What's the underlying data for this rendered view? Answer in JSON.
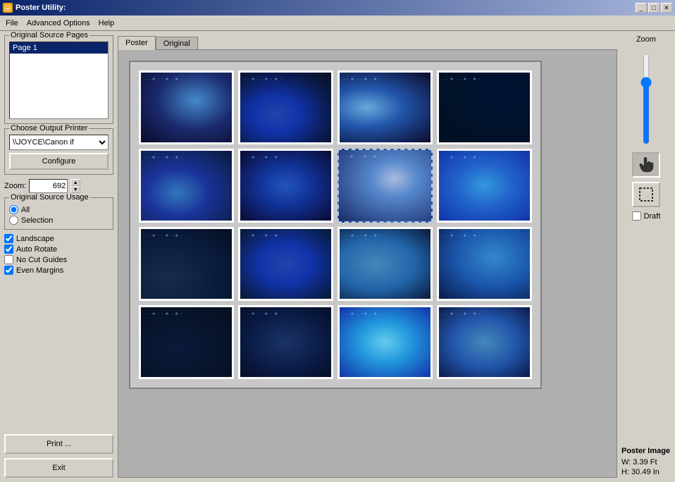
{
  "window": {
    "title": "Poster Utility:",
    "title_icon": "🖨"
  },
  "titlebar": {
    "minimize_label": "_",
    "maximize_label": "□",
    "close_label": "✕"
  },
  "menubar": {
    "items": [
      {
        "id": "file",
        "label": "File"
      },
      {
        "id": "advanced-options",
        "label": "Advanced Options"
      },
      {
        "id": "help",
        "label": "Help"
      }
    ]
  },
  "left_panel": {
    "source_pages_group_title": "Original Source Pages",
    "pages": [
      {
        "id": "page1",
        "label": "Page 1",
        "selected": true
      }
    ],
    "output_printer_group_title": "Choose Output Printer",
    "printer_value": "\\\\JOYCE\\Canon if",
    "configure_label": "Configure",
    "zoom_label": "Zoom:",
    "zoom_value": "692",
    "source_usage_group_title": "Original Source Usage",
    "radio_all_label": "All",
    "radio_selection_label": "Selection",
    "radio_all_checked": true,
    "radio_selection_checked": false,
    "checkbox_landscape_label": "Landscape",
    "checkbox_landscape_checked": true,
    "checkbox_auto_rotate_label": "Auto Rotate",
    "checkbox_auto_rotate_checked": true,
    "checkbox_no_cut_guides_label": "No Cut Guides",
    "checkbox_no_cut_guides_checked": false,
    "checkbox_even_margins_label": "Even Margins",
    "checkbox_even_margins_checked": true,
    "print_label": "Print ...",
    "exit_label": "Exit"
  },
  "center": {
    "tab_poster_label": "Poster",
    "tab_original_label": "Original",
    "active_tab": "poster"
  },
  "right_panel": {
    "zoom_label": "Zoom",
    "zoom_slider_value": 70,
    "hand_tool_icon": "✋",
    "select_tool_icon": "⬚",
    "draft_label": "Draft",
    "draft_checked": false,
    "poster_image_title": "Poster Image",
    "poster_width_label": "W: 3.39 Ft",
    "poster_height_label": "H: 30.49 In"
  },
  "poster_grid": {
    "cells": [
      {
        "id": 1,
        "class": "img-1"
      },
      {
        "id": 2,
        "class": "img-2"
      },
      {
        "id": 3,
        "class": "img-3"
      },
      {
        "id": 4,
        "class": "img-4"
      },
      {
        "id": 5,
        "class": "img-5"
      },
      {
        "id": 6,
        "class": "img-6"
      },
      {
        "id": 7,
        "class": "img-7",
        "dashed": true
      },
      {
        "id": 8,
        "class": "img-8"
      },
      {
        "id": 9,
        "class": "img-9"
      },
      {
        "id": 10,
        "class": "img-10"
      },
      {
        "id": 11,
        "class": "img-11"
      },
      {
        "id": 12,
        "class": "img-12"
      },
      {
        "id": 13,
        "class": "img-13"
      },
      {
        "id": 14,
        "class": "img-14"
      },
      {
        "id": 15,
        "class": "img-15"
      },
      {
        "id": 16,
        "class": "img-16"
      }
    ]
  }
}
